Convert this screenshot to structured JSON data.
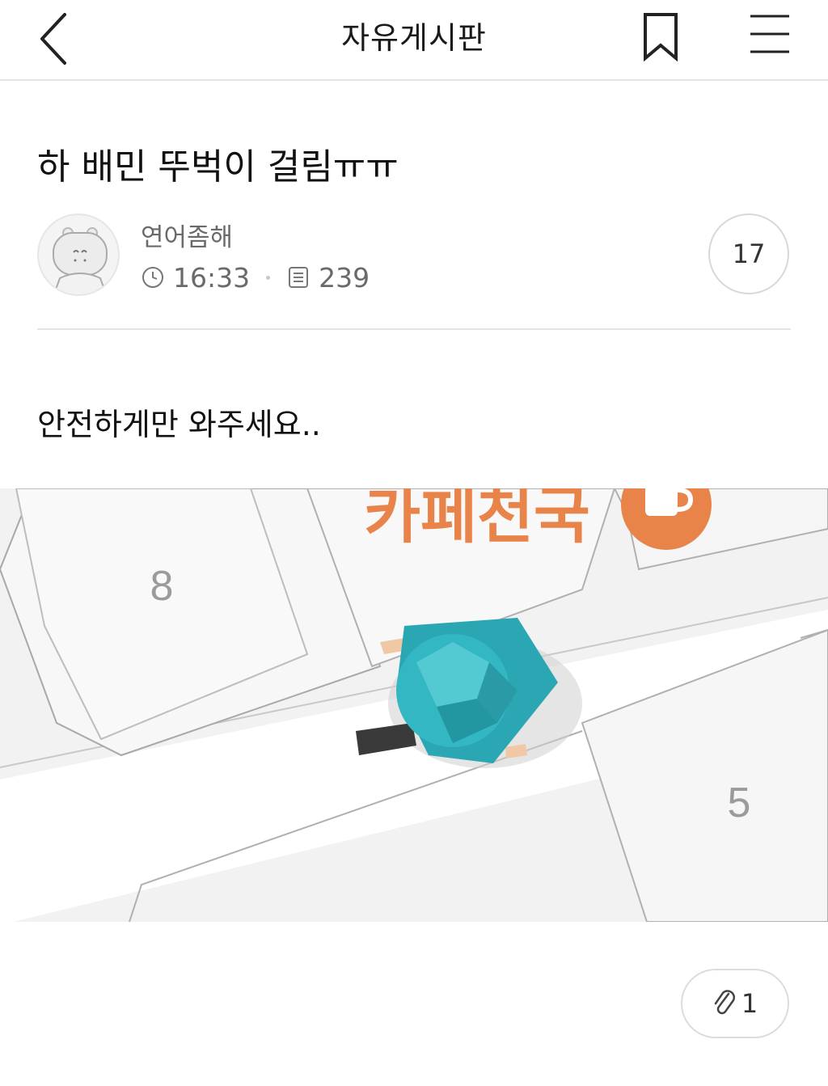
{
  "header": {
    "title": "자유게시판"
  },
  "post": {
    "title": "하 배민 뚜벅이 걸림ㅠㅠ",
    "author": "연어좀해",
    "time": "16:33",
    "views": "239",
    "comment_count": "17",
    "body": "안전하게만 와주세요..",
    "attachment_count": "1"
  },
  "map_image": {
    "cafe_label": "카페천국",
    "block_left": "8",
    "block_right": "5",
    "cafe_color": "#E8844A",
    "character_color": "#2BA7B4"
  },
  "icons": [
    "back-arrow-icon",
    "bookmark-icon",
    "menu-icon",
    "clock-icon",
    "views-icon",
    "paperclip-icon"
  ]
}
